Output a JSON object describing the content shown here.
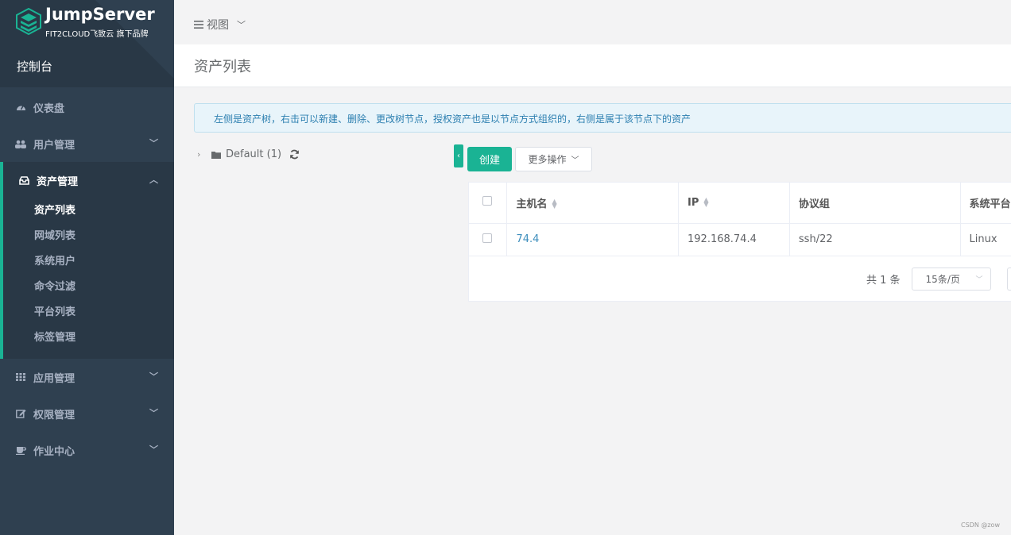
{
  "brand": {
    "title": "JumpServer",
    "subtitle": "FIT2CLOUD飞致云 旗下品牌",
    "console_label": "控制台"
  },
  "sidebar": {
    "items": [
      {
        "label": "仪表盘",
        "icon": "dashboard-icon"
      },
      {
        "label": "用户管理",
        "icon": "users-icon"
      },
      {
        "label": "资产管理",
        "icon": "inbox-icon"
      },
      {
        "label": "应用管理",
        "icon": "grid-icon"
      },
      {
        "label": "权限管理",
        "icon": "edit-icon"
      },
      {
        "label": "作业中心",
        "icon": "coffee-icon"
      }
    ],
    "asset_submenu": [
      "资产列表",
      "网域列表",
      "系统用户",
      "命令过滤",
      "平台列表",
      "标签管理"
    ]
  },
  "topbar": {
    "view_label": "视图"
  },
  "page": {
    "title": "资产列表",
    "info": "左侧是资产树，右击可以新建、删除、更改树节点，授权资产也是以节点方式组织的，右侧是属于该节点下的资产"
  },
  "tree": {
    "node_label": "Default (1)"
  },
  "toolbar": {
    "create_label": "创建",
    "more_label": "更多操作"
  },
  "table": {
    "columns": [
      "主机名",
      "IP",
      "协议组",
      "系统平台"
    ],
    "rows": [
      {
        "hostname": "74.4",
        "ip": "192.168.74.4",
        "protocols": "ssh/22",
        "platform": "Linux"
      }
    ]
  },
  "pagination": {
    "total": "共 1 条",
    "page_size": "15条/页"
  },
  "watermark": "CSDN @zow",
  "colors": {
    "accent": "#1ab394",
    "sidebar": "#2f4050",
    "link": "#3c8dbc"
  }
}
